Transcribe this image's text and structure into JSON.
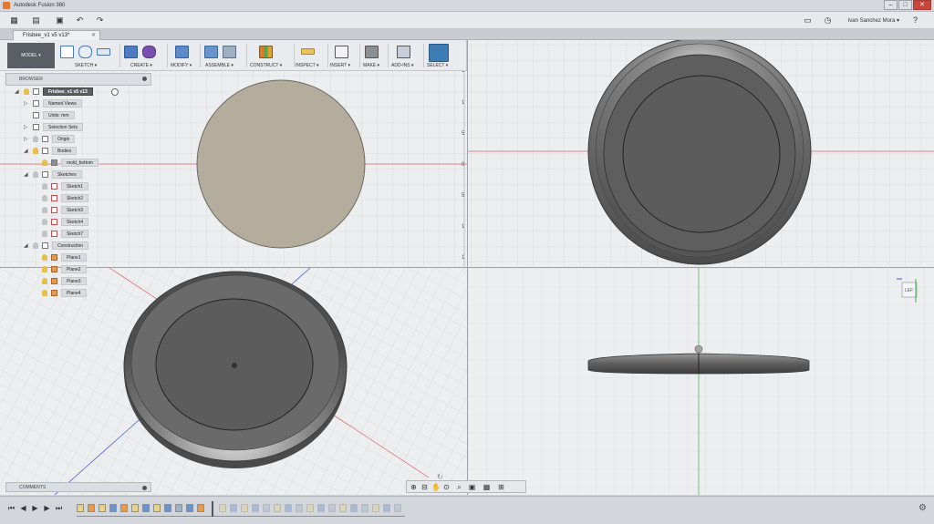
{
  "window": {
    "title": "Autodesk Fusion 360"
  },
  "quick_access": {
    "user_name": "Ivan Sanchez Mora ▾",
    "help_label": "?"
  },
  "document_tab": {
    "name": "Frisbee_v1 v5 v13*",
    "close": "✕"
  },
  "toolbar": {
    "workspace": "MODEL ▾",
    "groups": [
      {
        "label": "SKETCH ▾"
      },
      {
        "label": "CREATE ▾"
      },
      {
        "label": "MODIFY ▾"
      },
      {
        "label": "ASSEMBLE ▾"
      },
      {
        "label": "CONSTRUCT ▾"
      },
      {
        "label": "INSPECT ▾"
      },
      {
        "label": "INSERT ▾"
      },
      {
        "label": "MAKE ▾"
      },
      {
        "label": "ADD-INS ▾"
      },
      {
        "label": "SELECT ▾"
      }
    ]
  },
  "browser": {
    "title": "BROWSER",
    "root": "Frisbee_v1 v5 v13",
    "nodes": [
      {
        "label": "Named Views"
      },
      {
        "label": "Units: mm"
      },
      {
        "label": "Selection Sets"
      },
      {
        "label": "Origin"
      },
      {
        "label": "Bodies"
      },
      {
        "label": "mold_bottom"
      },
      {
        "label": "Sketches"
      },
      {
        "label": "Sketch1"
      },
      {
        "label": "Sketch2"
      },
      {
        "label": "Sketch3"
      },
      {
        "label": "Sketch4"
      },
      {
        "label": "Sketch7"
      },
      {
        "label": "Construction"
      },
      {
        "label": "Plane1"
      },
      {
        "label": "Plane2"
      },
      {
        "label": "Plane3"
      },
      {
        "label": "Plane4"
      }
    ]
  },
  "comments": {
    "title": "COMMENTS"
  },
  "viewcube": {
    "label": "LEF"
  },
  "axis_ticks": [
    "1",
    "1",
    "5",
    "0",
    "5",
    "1",
    "1"
  ],
  "colors": {
    "accent": "#3a7fc1",
    "select_active": "#3e7cb4",
    "body_fill": "#5e5e5e",
    "sketch_fill": "#b4ac9c",
    "axis_red": "#e06060",
    "axis_green": "#40b040",
    "axis_blue": "#4050d0"
  }
}
